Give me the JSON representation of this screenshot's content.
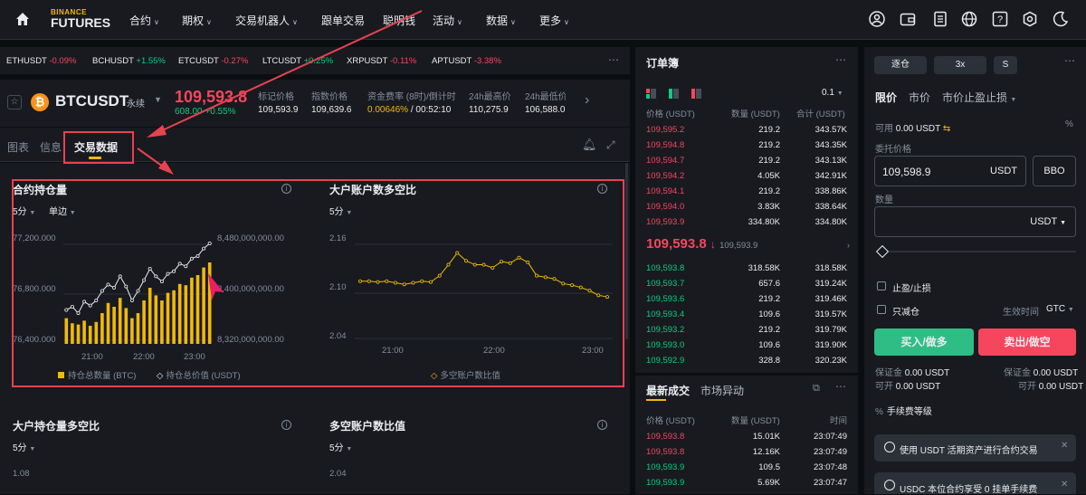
{
  "nav": {
    "logo_top": "BINANCE",
    "logo_bottom": "FUTURES",
    "items": [
      "合约",
      "期权",
      "交易机器人",
      "跟单交易",
      "聪明钱",
      "活动",
      "数据",
      "更多"
    ]
  },
  "ticker": [
    {
      "sym": "ETHUSDT",
      "chg": "-0.09%"
    },
    {
      "sym": "BCHUSDT",
      "chg": "+1.55%"
    },
    {
      "sym": "ETCUSDT",
      "chg": "-0.27%"
    },
    {
      "sym": "LTCUSDT",
      "chg": "+0.25%"
    },
    {
      "sym": "XRPUSDT",
      "chg": "-0.11%"
    },
    {
      "sym": "APTUSDT",
      "chg": "-3.38%"
    }
  ],
  "header": {
    "symbol": "BTCUSDT",
    "type": "永续",
    "price": "109,593.8",
    "change": "608.00 +0.55%",
    "stats": [
      {
        "label": "标记价格",
        "value": "109,593.9"
      },
      {
        "label": "指数价格",
        "value": "109,639.6"
      },
      {
        "label": "资金费率 (8时)/倒计时",
        "value": "0.00646%",
        "value2": "/ 00:52:10"
      },
      {
        "label": "24h最高价",
        "value": "110,275.9"
      },
      {
        "label": "24h最低价",
        "value": "106,588.0"
      }
    ]
  },
  "tabs": [
    "图表",
    "信息",
    "交易数据"
  ],
  "cards": {
    "oi": {
      "title": "合约持仓量",
      "interval": "5分",
      "mode": "单边",
      "y_left": [
        "77,200.000",
        "76,800.000",
        "76,400.000"
      ],
      "y_right": [
        "8,480,000,000.00",
        "8,400,000,000.00",
        "8,320,000,000.00"
      ],
      "x": [
        "21:00",
        "22:00",
        "23:00"
      ],
      "legend1": "持仓总数量 (BTC)",
      "legend2": "持仓总价值 (USDT)"
    },
    "ls": {
      "title": "大户账户数多空比",
      "interval": "5分",
      "y": [
        "2.16",
        "2.10",
        "2.04"
      ],
      "x": [
        "21:00",
        "22:00",
        "23:00"
      ],
      "legend": "多空账户数比值"
    },
    "pos": {
      "title": "大户持仓量多空比",
      "interval": "5分",
      "y": "1.08"
    },
    "acc": {
      "title": "多空账户数比值",
      "interval": "5分",
      "y": "2.04"
    }
  },
  "chart_data": [
    {
      "type": "bar",
      "title": "合约持仓量",
      "series": [
        {
          "name": "持仓总数量 (BTC)",
          "values": [
            76560,
            76520,
            76510,
            76540,
            76500,
            76530,
            76600,
            76680,
            76650,
            76720,
            76640,
            76560,
            76600,
            76700,
            76800,
            76740,
            76700,
            76760,
            76780,
            76830,
            76820,
            76880,
            76900,
            76960,
            77000
          ]
        },
        {
          "name": "持仓总价值 (USDT)",
          "values": [
            8365,
            8370,
            8360,
            8378,
            8372,
            8380,
            8395,
            8405,
            8400,
            8418,
            8402,
            8380,
            8395,
            8412,
            8430,
            8418,
            8410,
            8422,
            8426,
            8438,
            8434,
            8446,
            8450,
            8462,
            8470
          ]
        }
      ],
      "ylim": [
        76400,
        77200
      ]
    },
    {
      "type": "line",
      "title": "大户账户数多空比",
      "series": [
        {
          "name": "多空账户数比值",
          "values": [
            2.113,
            2.113,
            2.112,
            2.113,
            2.111,
            2.109,
            2.111,
            2.113,
            2.112,
            2.12,
            2.134,
            2.149,
            2.139,
            2.134,
            2.134,
            2.13,
            2.138,
            2.136,
            2.143,
            2.137,
            2.12,
            2.118,
            2.116,
            2.11,
            2.108,
            2.105,
            2.101,
            2.095,
            2.093
          ]
        }
      ],
      "ylim": [
        2.04,
        2.16
      ]
    }
  ],
  "orderbook": {
    "title": "订单簿",
    "tick": "0.1",
    "cols": [
      "价格 (USDT)",
      "数量 (USDT)",
      "合计 (USDT)"
    ],
    "asks": [
      [
        "109,595.2",
        "219.2",
        "343.57K"
      ],
      [
        "109,594.8",
        "219.2",
        "343.35K"
      ],
      [
        "109,594.7",
        "219.2",
        "343.13K"
      ],
      [
        "109,594.2",
        "4.05K",
        "342.91K"
      ],
      [
        "109,594.1",
        "219.2",
        "338.86K"
      ],
      [
        "109,594.0",
        "3.83K",
        "338.64K"
      ],
      [
        "109,593.9",
        "334.80K",
        "334.80K"
      ]
    ],
    "mid": "109,593.8",
    "mid_sub": "109,593.9",
    "bids": [
      [
        "109,593.8",
        "318.58K",
        "318.58K"
      ],
      [
        "109,593.7",
        "657.6",
        "319.24K"
      ],
      [
        "109,593.6",
        "219.2",
        "319.46K"
      ],
      [
        "109,593.4",
        "109.6",
        "319.57K"
      ],
      [
        "109,593.2",
        "219.2",
        "319.79K"
      ],
      [
        "109,593.0",
        "109.6",
        "319.90K"
      ],
      [
        "109,592.9",
        "328.8",
        "320.23K"
      ]
    ]
  },
  "trades": {
    "tabs": [
      "最新成交",
      "市场异动"
    ],
    "cols": [
      "价格 (USDT)",
      "数量 (USDT)",
      "时间"
    ],
    "rows": [
      [
        "109,593.8",
        "15.01K",
        "23:07:49",
        "down"
      ],
      [
        "109,593.8",
        "12.16K",
        "23:07:49",
        "down"
      ],
      [
        "109,593.9",
        "109.5",
        "23:07:48",
        "up"
      ],
      [
        "109,593.9",
        "5.69K",
        "23:07:47",
        "up"
      ]
    ]
  },
  "order": {
    "margin_mode": "逐仓",
    "leverage": "3x",
    "asset_mode": "S",
    "types": [
      "限价",
      "市价",
      "市价止盈止损"
    ],
    "available_label": "可用",
    "available": "0.00 USDT",
    "price_label": "委托价格",
    "price": "109,598.9",
    "price_unit": "USDT",
    "bbo": "BBO",
    "qty_label": "数量",
    "qty_unit": "USDT",
    "tpsl": "止盈/止损",
    "reduce": "只减仓",
    "tif_label": "生效时间",
    "tif": "GTC",
    "buy": "买入/做多",
    "sell": "卖出/做空",
    "margin_label": "保证金",
    "margin_buy": "0.00 USDT",
    "margin_sell": "0.00 USDT",
    "open_label": "可开",
    "open_buy": "0.00 USDT",
    "open_sell": "0.00 USDT",
    "fee": "手续费等级",
    "promo1": "使用 USDT 活期资产进行合约交易",
    "promo2": "USDC 本位合约享受 0 挂单手续费"
  },
  "colors": {
    "accent": "#f0b90b",
    "up": "#0ecb81",
    "down": "#f6465d",
    "annotation": "#e8424f"
  }
}
